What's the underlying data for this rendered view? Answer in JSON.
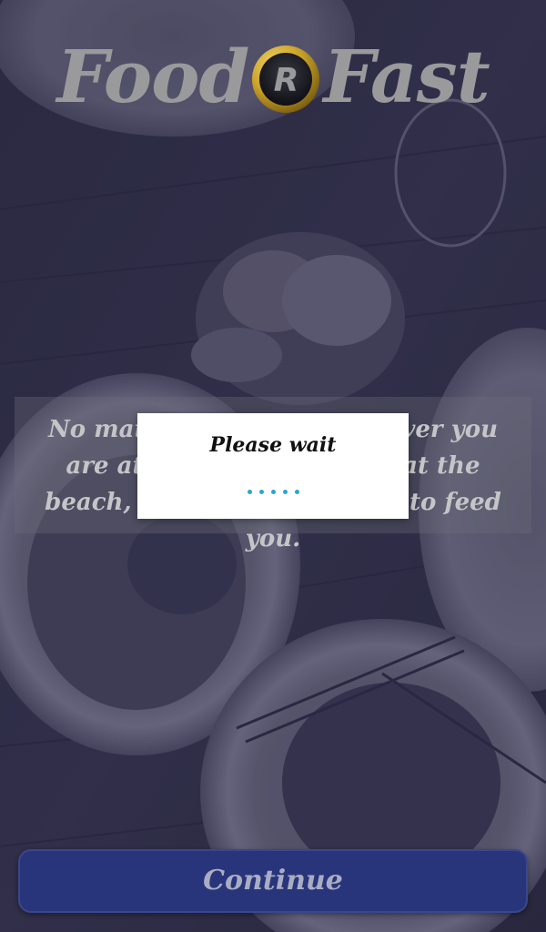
{
  "app": {
    "logo_left": "Food",
    "logo_registered_mark": "R",
    "logo_right": "Fast"
  },
  "intro": {
    "tagline": "No matter where or whenever you are at home, at office, or at the beach, we will find our way to feed you."
  },
  "dialog": {
    "title": "Please wait",
    "progress_dots": 5,
    "accent_color": "#2aa6d0"
  },
  "footer": {
    "continue_label": "Continue"
  },
  "colors": {
    "button_bg": "#29357a",
    "logo_text": "#9a9a9c",
    "logo_gold": "#c9a227"
  }
}
